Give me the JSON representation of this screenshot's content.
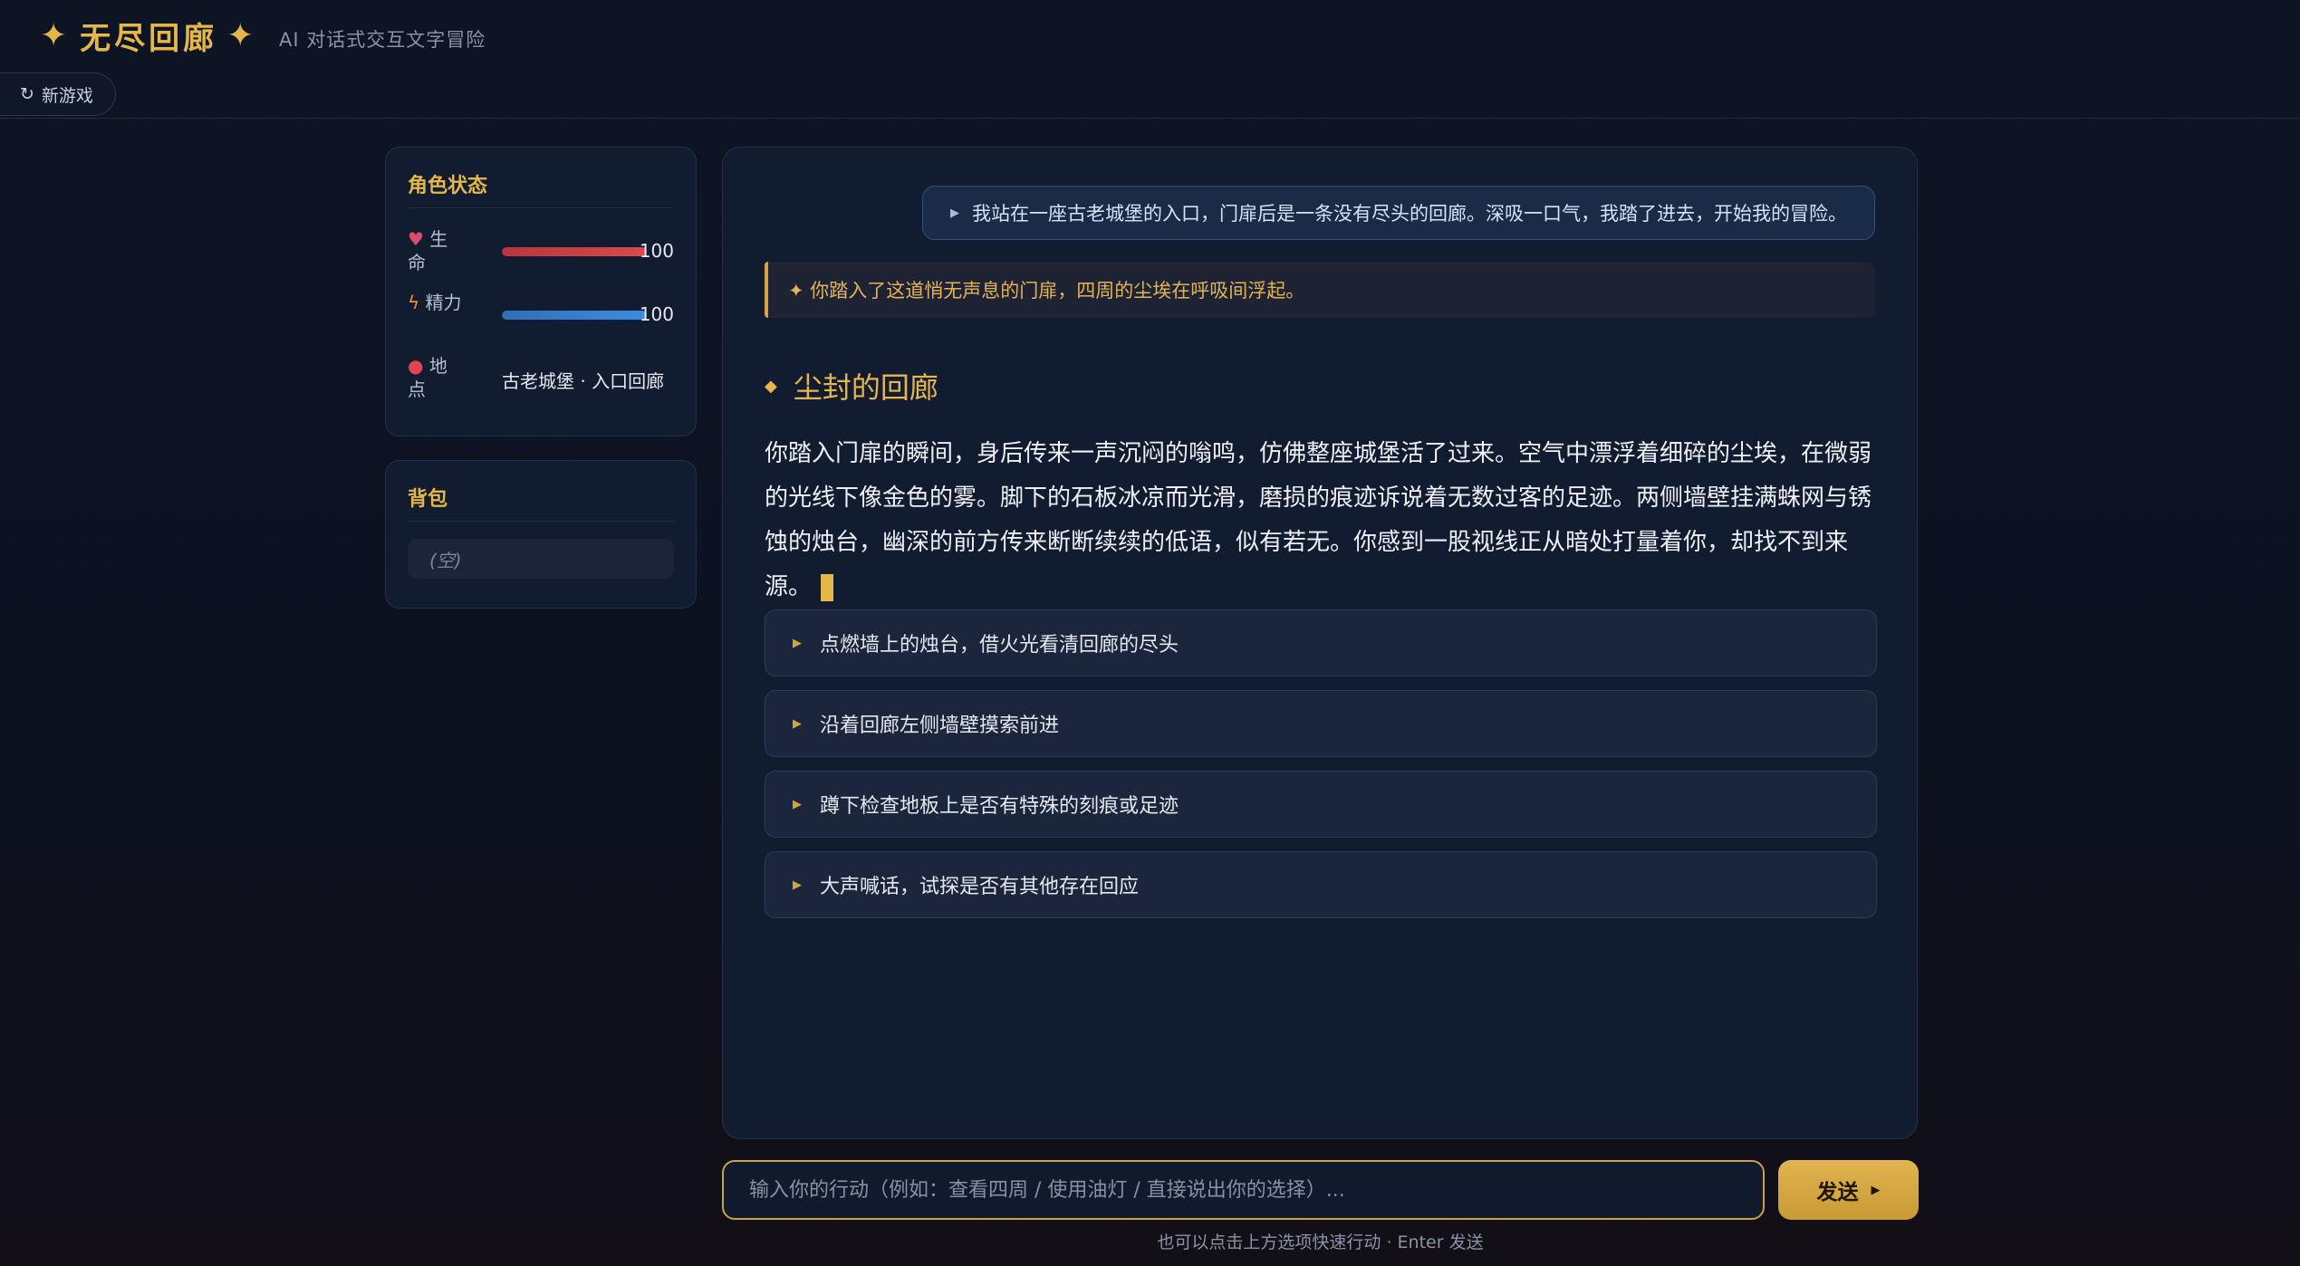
{
  "header": {
    "title": "无尽回廊",
    "star_glyph": "✦",
    "subtitle": "AI 对话式交互文字冒险",
    "new_game_label": "新游戏"
  },
  "status_panel": {
    "title": "角色状态",
    "hp": {
      "icon": "heart-icon",
      "label": "生命",
      "value": "100",
      "fraction": 1.0,
      "color": "#d9494b"
    },
    "energy": {
      "icon": "lightning-icon",
      "label": "精力",
      "value": "100",
      "fraction": 1.0,
      "color": "#3d8ce0"
    },
    "location": {
      "icon": "pin-icon",
      "label": "地点",
      "value": "古老城堡 · 入口回廊"
    }
  },
  "inventory_panel": {
    "title": "背包",
    "empty_text": "(空)"
  },
  "story": {
    "user_message": "我站在一座古老城堡的入口，门扉后是一条没有尽头的回廊。深吸一口气，我踏了进去，开始我的冒险。",
    "narration_note": "✦ 你踏入了这道悄无声息的门扉，四周的尘埃在呼吸间浮起。",
    "scene_title": "尘封的回廊",
    "scene_text": "你踏入门扉的瞬间，身后传来一声沉闷的嗡鸣，仿佛整座城堡活了过来。空气中漂浮着细碎的尘埃，在微弱的光线下像金色的雾。脚下的石板冰凉而光滑，磨损的痕迹诉说着无数过客的足迹。两侧墙壁挂满蛛网与锈蚀的烛台，幽深的前方传来断断续续的低语，似有若无。你感到一股视线正从暗处打量着你，却找不到来源。",
    "options": [
      "点燃墙上的烛台，借火光看清回廊的尽头",
      "沿着回廊左侧墙壁摸索前进",
      "蹲下检查地板上是否有特殊的刻痕或足迹",
      "大声喊话，试探是否有其他存在回应"
    ]
  },
  "input": {
    "placeholder": "输入你的行动（例如：查看四周 / 使用油灯 / 直接说出你的选择）...",
    "value": "",
    "send_label": "发送",
    "hint": "也可以点击上方选项快速行动 · Enter 发送"
  },
  "colors": {
    "accent": "#e5b64a",
    "background": "#0d1424",
    "panel": "#121c30"
  }
}
